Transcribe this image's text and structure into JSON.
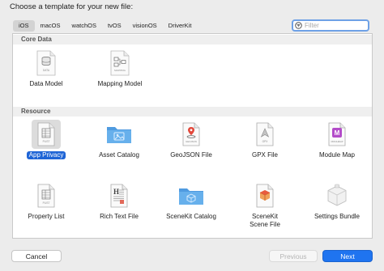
{
  "title": "Choose a template for your new file:",
  "platform_tabs": [
    {
      "label": "iOS",
      "active": true
    },
    {
      "label": "macOS",
      "active": false
    },
    {
      "label": "watchOS",
      "active": false
    },
    {
      "label": "tvOS",
      "active": false
    },
    {
      "label": "visionOS",
      "active": false
    },
    {
      "label": "DriverKit",
      "active": false
    }
  ],
  "filter": {
    "placeholder": "Filter",
    "value": ""
  },
  "sections": [
    {
      "header": "Core Data",
      "items": [
        {
          "label": "Data Model",
          "icon": "data-model-icon",
          "icon_caption": "DATA"
        },
        {
          "label": "Mapping Model",
          "icon": "mapping-model-icon",
          "icon_caption": "MAPPING"
        }
      ]
    },
    {
      "header": "Resource",
      "items": [
        {
          "label": "App Privacy",
          "icon": "plist-icon",
          "icon_caption": "PLIST",
          "selected": true
        },
        {
          "label": "Asset Catalog",
          "icon": "asset-catalog-folder-icon"
        },
        {
          "label": "GeoJSON File",
          "icon": "geojson-icon",
          "icon_caption": "GEOJSON"
        },
        {
          "label": "GPX File",
          "icon": "gpx-icon",
          "icon_caption": "GPX"
        },
        {
          "label": "Module Map",
          "icon": "module-map-icon",
          "icon_caption": "MODULEMAP"
        },
        {
          "label": "Property List",
          "icon": "plist-icon",
          "icon_caption": "PLIST"
        },
        {
          "label": "Rich Text File",
          "icon": "rich-text-icon"
        },
        {
          "label": "SceneKit Catalog",
          "icon": "scenekit-catalog-folder-icon"
        },
        {
          "label": "SceneKit\nScene File",
          "icon": "scenekit-scene-icon"
        },
        {
          "label": "Settings Bundle",
          "icon": "settings-bundle-icon"
        }
      ]
    }
  ],
  "buttons": {
    "cancel": "Cancel",
    "previous": "Previous",
    "next": "Next"
  },
  "colors": {
    "accent": "#1f74f0",
    "selection": "#1f65d6",
    "folder": "#5fa8e6"
  }
}
